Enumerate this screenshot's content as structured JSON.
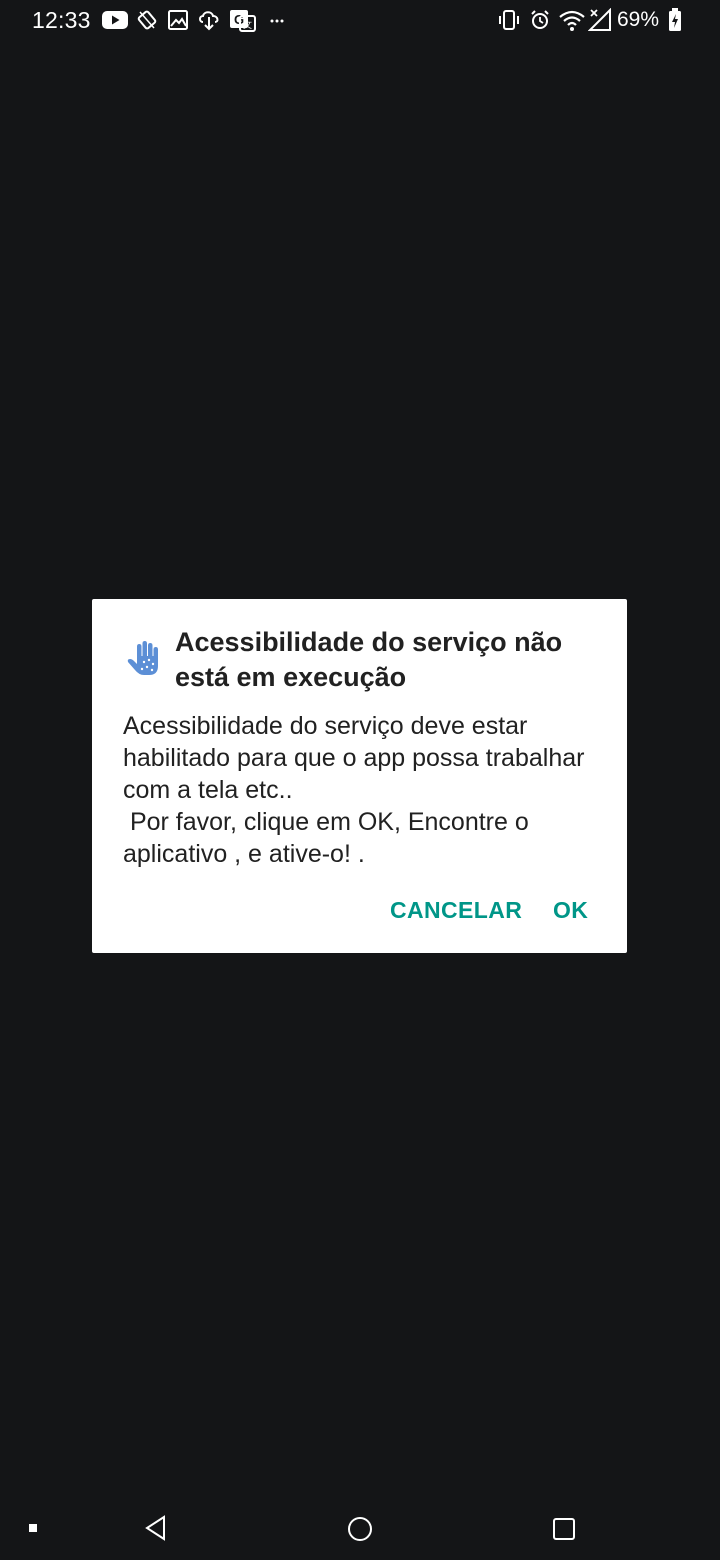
{
  "status_bar": {
    "time": "12:33",
    "battery_percent": "69%",
    "left_icons": [
      "youtube-icon",
      "rotate-lock-icon",
      "image-icon",
      "download-icon",
      "translate-icon",
      "more-icon"
    ],
    "right_icons": [
      "vibrate-icon",
      "alarm-icon",
      "wifi-icon",
      "signal-icon",
      "battery-icon"
    ]
  },
  "dialog": {
    "icon": "accessibility-hand-icon",
    "title": "Acessibilidade do serviço não está em execução",
    "message": "Acessibilidade do serviço deve estar habilitado para que o app possa trabalhar com a tela etc..\n Por favor, clique em OK, Encontre o aplicativo , e ative-o! .",
    "cancel_label": "CANCELAR",
    "ok_label": "OK"
  },
  "nav_bar": {
    "items": [
      "dot-icon",
      "back-icon",
      "home-icon",
      "recents-icon"
    ]
  },
  "colors": {
    "background": "#141517",
    "dialog_background": "#ffffff",
    "accent": "#009688",
    "text": "#212121",
    "icon_blue": "#5c8fd6"
  }
}
